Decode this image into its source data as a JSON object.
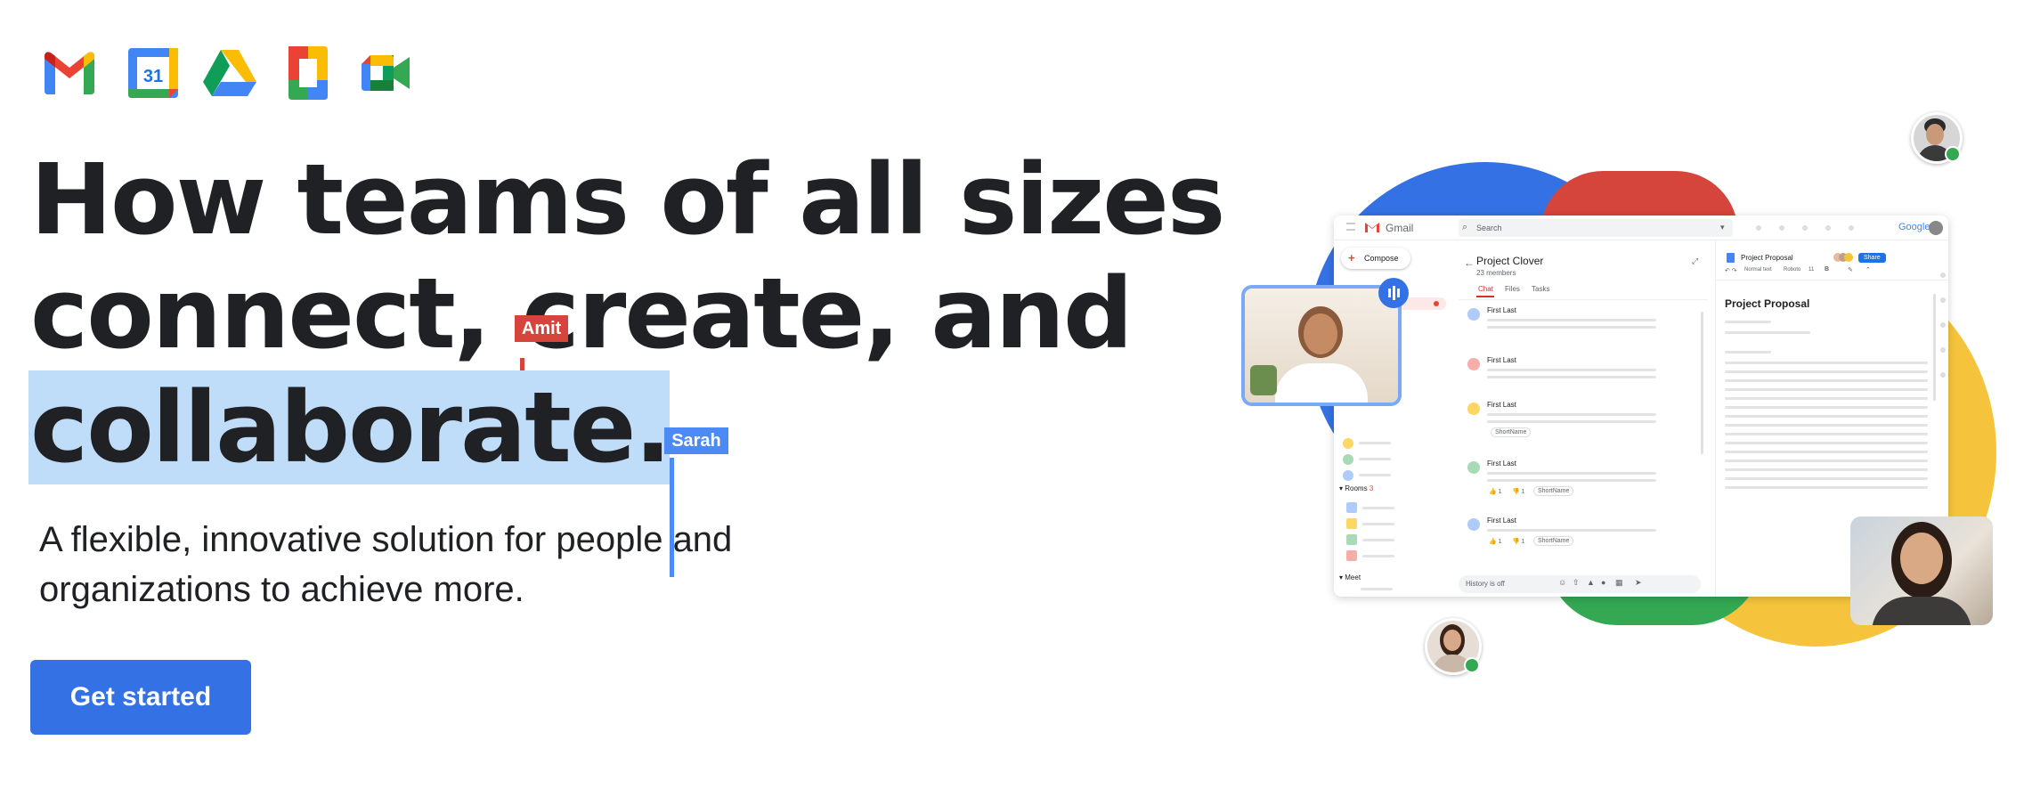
{
  "apps": [
    {
      "name": "Gmail"
    },
    {
      "name": "Calendar",
      "label": "31"
    },
    {
      "name": "Drive"
    },
    {
      "name": "Docs"
    },
    {
      "name": "Meet"
    }
  ],
  "headline": {
    "line1": "How teams of all sizes",
    "line2_a": "connect, ",
    "line2_b": "create, and",
    "line3": "collaborate."
  },
  "cursors": {
    "amit": {
      "label": "Amit",
      "color": "#d6453b"
    },
    "sarah": {
      "label": "Sarah",
      "color": "#4c8bf5"
    }
  },
  "subtitle": {
    "line1": "A flexible, innovative solution for people and",
    "line2": "organizations to achieve more."
  },
  "cta": {
    "label": "Get started"
  },
  "colors": {
    "blue": "#3471e4",
    "red": "#d6453b",
    "yellow": "#f6c43c",
    "green": "#34a853"
  },
  "mockup": {
    "app_name": "Gmail",
    "search_placeholder": "Search",
    "brand": "Google",
    "compose_label": "Compose",
    "space": {
      "title": "Project Clover",
      "members": "23 members"
    },
    "tabs": [
      "Chat",
      "Files",
      "Tasks"
    ],
    "messages": [
      {
        "author": "First Last"
      },
      {
        "author": "First Last"
      },
      {
        "author": "First Last",
        "chip": "ShortName"
      },
      {
        "author": "First Last",
        "reactions": [
          "👍 1",
          "👎 1"
        ],
        "chip": "ShortName"
      },
      {
        "author": "First Last",
        "reactions": [
          "👍 1",
          "👎 1"
        ],
        "chip": "ShortName"
      }
    ],
    "history_text": "History is off",
    "sidebar": {
      "rooms_label": "Rooms",
      "rooms_count": "3",
      "meet_label": "Meet"
    },
    "doc": {
      "tab_title": "Project Proposal",
      "share_label": "Share",
      "toolbar_style": "Normal text",
      "toolbar_font": "Roboto",
      "toolbar_size": "11",
      "toolbar_bold": "B",
      "heading": "Project Proposal"
    }
  }
}
